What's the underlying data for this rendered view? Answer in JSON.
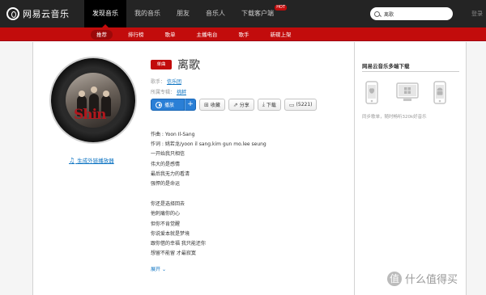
{
  "app": {
    "brand": "网易云音乐"
  },
  "topnav": {
    "items": [
      {
        "label": "发现音乐"
      },
      {
        "label": "我的音乐"
      },
      {
        "label": "朋友"
      },
      {
        "label": "音乐人"
      },
      {
        "label": "下载客户端",
        "badge": "HOT"
      }
    ]
  },
  "search": {
    "value": "离歌"
  },
  "login": {
    "label": "登录"
  },
  "subnav": {
    "items": [
      {
        "label": "推荐"
      },
      {
        "label": "排行榜"
      },
      {
        "label": "歌单"
      },
      {
        "label": "主播电台"
      },
      {
        "label": "歌手"
      },
      {
        "label": "新碟上架"
      }
    ]
  },
  "song": {
    "badge": "单曲",
    "title": "离歌",
    "singer_label": "歌手：",
    "singer": "信乐团",
    "album_label": "所属专辑：",
    "album": "挑衅",
    "mv_link": "生成外链播放器"
  },
  "actions": {
    "play": "播放",
    "add": "+",
    "collect": "收藏",
    "share": "分享",
    "download": "下载",
    "comments": "(5221)"
  },
  "lyrics": {
    "block1": [
      "作曲 : Yoon Il-Sang",
      "作词 : 姚若龙/yoon il sang.kim gun mo.lee seung",
      "一开始我只相信",
      "伟大的是感情",
      "最后我无力的看清",
      "强悍的是命运"
    ],
    "block2": [
      "你还是选择回去",
      "他刺痛你的心",
      "但你不肯觉醒",
      "你说爱本就是梦境",
      "跟你借的幸福 我只能还你",
      "想留不能留 才最寂寞"
    ],
    "expand": "展开"
  },
  "sidebar": {
    "title": "网易云音乐多端下载",
    "note": "同步歌单，随时畅听320k好音乐"
  },
  "watermark": {
    "text": "什么值得买",
    "logo": "值"
  },
  "colors": {
    "brand_red": "#c20c0c",
    "link_blue": "#0c73c2",
    "topbar": "#242424"
  }
}
